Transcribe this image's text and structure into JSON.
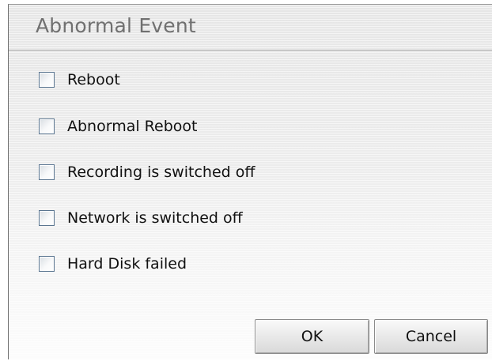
{
  "dialog": {
    "title": "Abnormal Event",
    "options": [
      {
        "label": "Reboot",
        "checked": false
      },
      {
        "label": "Abnormal Reboot",
        "checked": false
      },
      {
        "label": "Recording is switched off",
        "checked": false
      },
      {
        "label": "Network is switched off",
        "checked": false
      },
      {
        "label": "Hard Disk failed",
        "checked": false
      }
    ],
    "buttons": {
      "ok_label": "OK",
      "cancel_label": "Cancel"
    }
  }
}
